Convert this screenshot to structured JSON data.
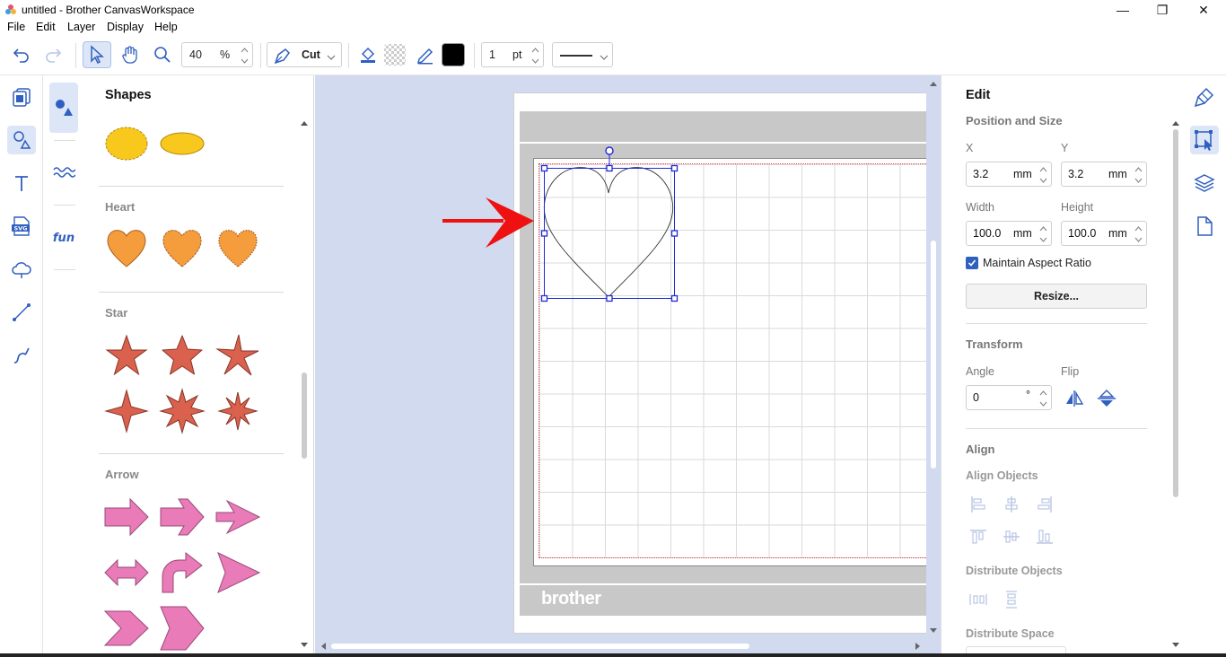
{
  "window": {
    "title": "untitled - Brother CanvasWorkspace",
    "minimize": "—",
    "restore": "❐",
    "close": "✕"
  },
  "menu": [
    "File",
    "Edit",
    "Layer",
    "Display",
    "Help"
  ],
  "toolbar": {
    "zoom_value": "40",
    "zoom_unit": "%",
    "mode_label": "Cut",
    "line_width_value": "1",
    "line_width_unit": "pt",
    "line_color": "#000000"
  },
  "shapes_panel": {
    "title": "Shapes",
    "categories": [
      "Heart",
      "Star",
      "Arrow"
    ],
    "colors": {
      "basic": "#f8c81c",
      "heart": "#f59c3c",
      "star": "#d9614e",
      "arrow": "#e87bb8"
    }
  },
  "canvas": {
    "mat_brand": "brother",
    "background": "#d2daf0",
    "selection_color": "#1f2ad6"
  },
  "edit_panel": {
    "title": "Edit",
    "position_size": {
      "header": "Position and Size",
      "x_label": "X",
      "x_value": "3.2",
      "x_unit": "mm",
      "y_label": "Y",
      "y_value": "3.2",
      "y_unit": "mm",
      "width_label": "Width",
      "width_value": "100.0",
      "width_unit": "mm",
      "height_label": "Height",
      "height_value": "100.0",
      "height_unit": "mm",
      "aspect_label": "Maintain Aspect Ratio",
      "resize_label": "Resize..."
    },
    "transform": {
      "header": "Transform",
      "angle_label": "Angle",
      "angle_value": "0",
      "angle_unit": "°",
      "flip_label": "Flip"
    },
    "align": {
      "header": "Align",
      "align_objects": "Align Objects",
      "distribute_objects": "Distribute Objects",
      "distribute_space": "Distribute Space"
    }
  },
  "accent_color": "#2f5fbf"
}
